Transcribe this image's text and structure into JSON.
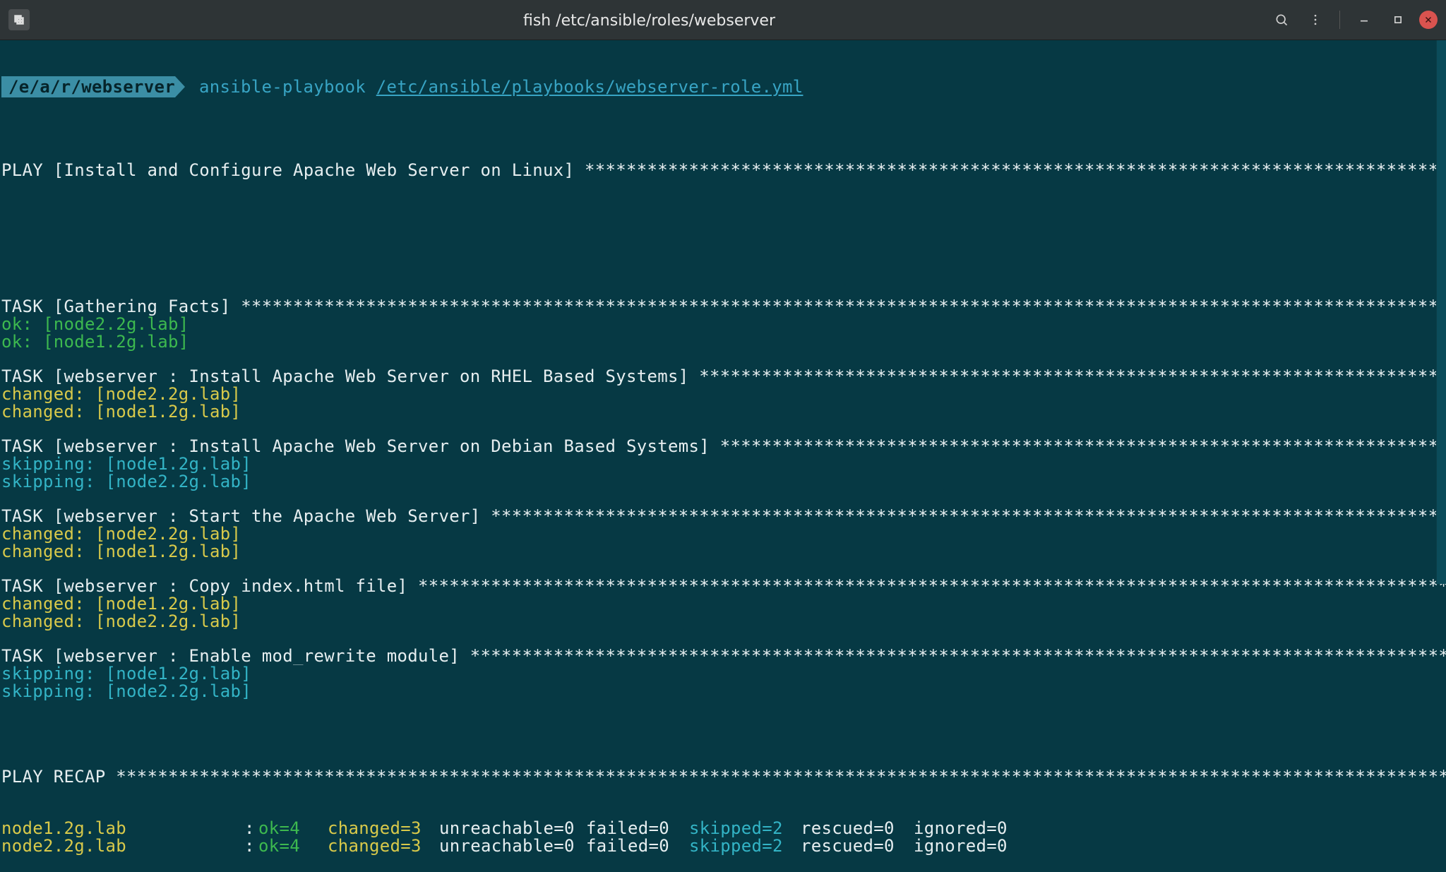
{
  "titlebar": {
    "title": "fish /etc/ansible/roles/webserver"
  },
  "prompt": {
    "path": "/e/a/r/webserver",
    "command": "ansible-playbook",
    "arg": "/etc/ansible/playbooks/webserver-role.yml"
  },
  "play": {
    "header": "PLAY [Install and Configure Apache Web Server on Linux] "
  },
  "tasks": [
    {
      "header": "TASK [Gathering Facts] ",
      "lines": [
        {
          "status": "ok",
          "label": "ok:",
          "host": "[node2.2g.lab]"
        },
        {
          "status": "ok",
          "label": "ok:",
          "host": "[node1.2g.lab]"
        }
      ]
    },
    {
      "header": "TASK [webserver : Install Apache Web Server on RHEL Based Systems] ",
      "lines": [
        {
          "status": "chg",
          "label": "changed:",
          "host": "[node2.2g.lab]"
        },
        {
          "status": "chg",
          "label": "changed:",
          "host": "[node1.2g.lab]"
        }
      ]
    },
    {
      "header": "TASK [webserver : Install Apache Web Server on Debian Based Systems] ",
      "lines": [
        {
          "status": "skip",
          "label": "skipping:",
          "host": "[node1.2g.lab]"
        },
        {
          "status": "skip",
          "label": "skipping:",
          "host": "[node2.2g.lab]"
        }
      ]
    },
    {
      "header": "TASK [webserver : Start the Apache Web Server] ",
      "lines": [
        {
          "status": "chg",
          "label": "changed:",
          "host": "[node2.2g.lab]"
        },
        {
          "status": "chg",
          "label": "changed:",
          "host": "[node1.2g.lab]"
        }
      ]
    },
    {
      "header": "TASK [webserver : Copy index.html file] ",
      "lines": [
        {
          "status": "chg",
          "label": "changed:",
          "host": "[node1.2g.lab]"
        },
        {
          "status": "chg",
          "label": "changed:",
          "host": "[node2.2g.lab]"
        }
      ]
    },
    {
      "header": "TASK [webserver : Enable mod_rewrite module] ",
      "lines": [
        {
          "status": "skip",
          "label": "skipping:",
          "host": "[node1.2g.lab]"
        },
        {
          "status": "skip",
          "label": "skipping:",
          "host": "[node2.2g.lab]"
        }
      ]
    }
  ],
  "recap": {
    "header": "PLAY RECAP ",
    "rows": [
      {
        "host": "node1.2g.lab",
        "ok": "ok=4",
        "changed": "changed=3",
        "unreachable": "unreachable=0",
        "failed": "failed=0",
        "skipped": "skipped=2",
        "rescued": "rescued=0",
        "ignored": "ignored=0"
      },
      {
        "host": "node2.2g.lab",
        "ok": "ok=4",
        "changed": "changed=3",
        "unreachable": "unreachable=0",
        "failed": "failed=0",
        "skipped": "skipped=2",
        "rescued": "rescued=0",
        "ignored": "ignored=0"
      }
    ]
  },
  "fill": "*****************************************************************************************************************************************************************************"
}
